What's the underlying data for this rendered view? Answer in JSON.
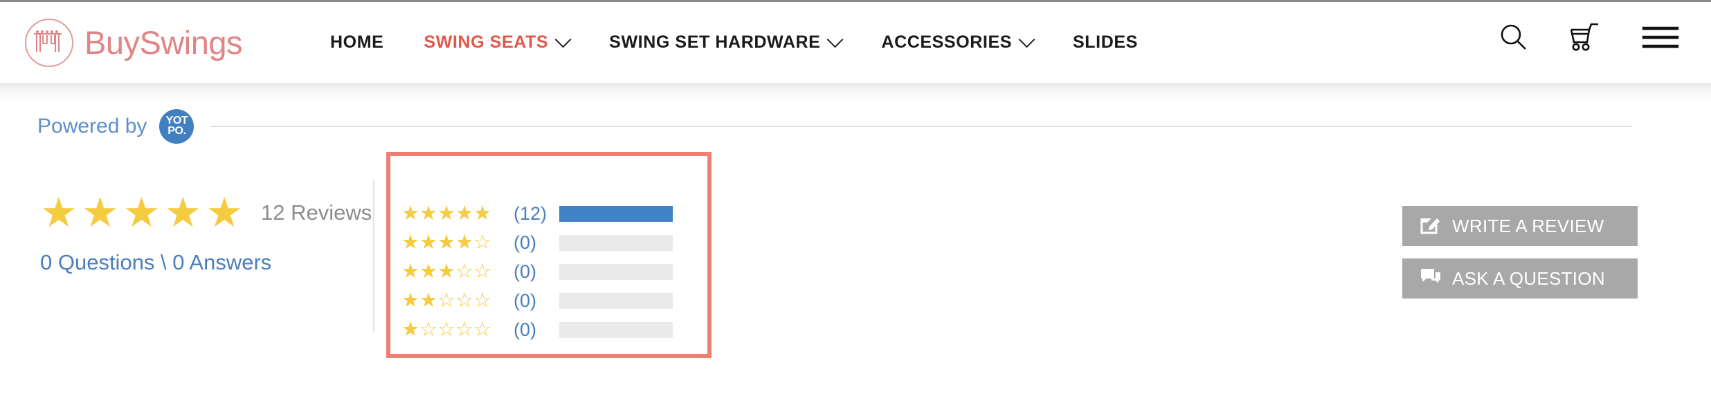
{
  "header": {
    "brand_name": "BuySwings",
    "logo_icon": "swing-set-icon",
    "nav": [
      {
        "label": "HOME",
        "has_caret": false,
        "active": false
      },
      {
        "label": "SWING SEATS",
        "has_caret": true,
        "active": true
      },
      {
        "label": "SWING SET HARDWARE",
        "has_caret": true,
        "active": false
      },
      {
        "label": "ACCESSORIES",
        "has_caret": true,
        "active": false
      },
      {
        "label": "SLIDES",
        "has_caret": false,
        "active": false
      }
    ],
    "icons": [
      {
        "name": "search-icon"
      },
      {
        "name": "cart-icon"
      },
      {
        "name": "hamburger-menu-icon"
      }
    ],
    "accent_color": "#e2574c",
    "brand_color": "#e08585"
  },
  "powered_by": {
    "text": "Powered by",
    "badge_line1": "YOT",
    "badge_line2": "PO.",
    "badge_color": "#4180c0",
    "text_color": "#5b8fc9"
  },
  "summary": {
    "overall_stars_filled": 5,
    "overall_stars_total": 5,
    "reviews_label": "12 Reviews",
    "qa_label": "0 Questions \\ 0 Answers",
    "star_color": "#f5cb3f",
    "link_color": "#4a7fbe",
    "muted_color": "#8c8c8c",
    "highlight_color": "#ee8073"
  },
  "actions": [
    {
      "label": "WRITE A REVIEW",
      "icon": "write-review-icon"
    },
    {
      "label": "ASK A QUESTION",
      "icon": "ask-question-icon"
    }
  ],
  "chart_data": {
    "type": "bar",
    "title": "Review rating distribution",
    "orientation": "horizontal",
    "categories": [
      "5 stars",
      "4 stars",
      "3 stars",
      "2 stars",
      "1 star"
    ],
    "values": [
      12,
      0,
      0,
      0,
      0
    ],
    "count_labels": [
      "(12)",
      "(0)",
      "(0)",
      "(0)",
      "(0)"
    ],
    "star_labels": [
      "★★★★★",
      "★★★★☆",
      "★★★☆☆",
      "★★☆☆☆",
      "★☆☆☆☆"
    ],
    "filled_stars": [
      5,
      4,
      3,
      2,
      1
    ],
    "xlim": [
      0,
      12
    ],
    "total_reviews": 12,
    "bar_color": "#4183c4",
    "track_color": "#eaeaea",
    "grid": false,
    "legend": false,
    "xlabel": "",
    "ylabel": ""
  }
}
